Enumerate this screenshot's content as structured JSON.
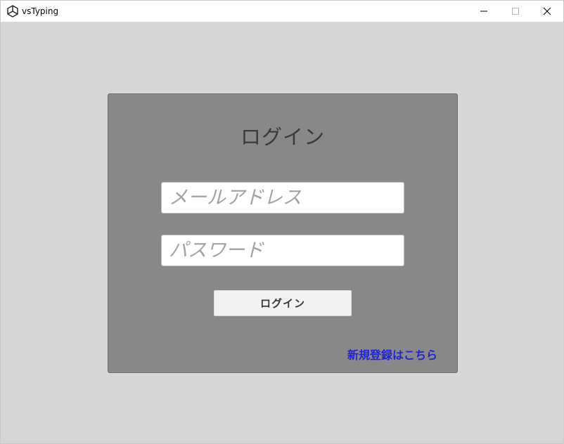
{
  "window": {
    "title": "vsTyping",
    "app_icon": "unity-logo-icon",
    "controls": [
      "minimize-icon",
      "maximize-icon",
      "close-icon"
    ]
  },
  "login": {
    "heading": "ログイン",
    "email_placeholder": "メールアドレス",
    "email_value": "",
    "password_placeholder": "パスワード",
    "password_value": "",
    "submit_label": "ログイン",
    "register_link": "新規登録はこちら"
  },
  "colors": {
    "background": "#d6d6d6",
    "panel": "#888888",
    "link": "#2323d6",
    "button": "#f2f2f2"
  }
}
